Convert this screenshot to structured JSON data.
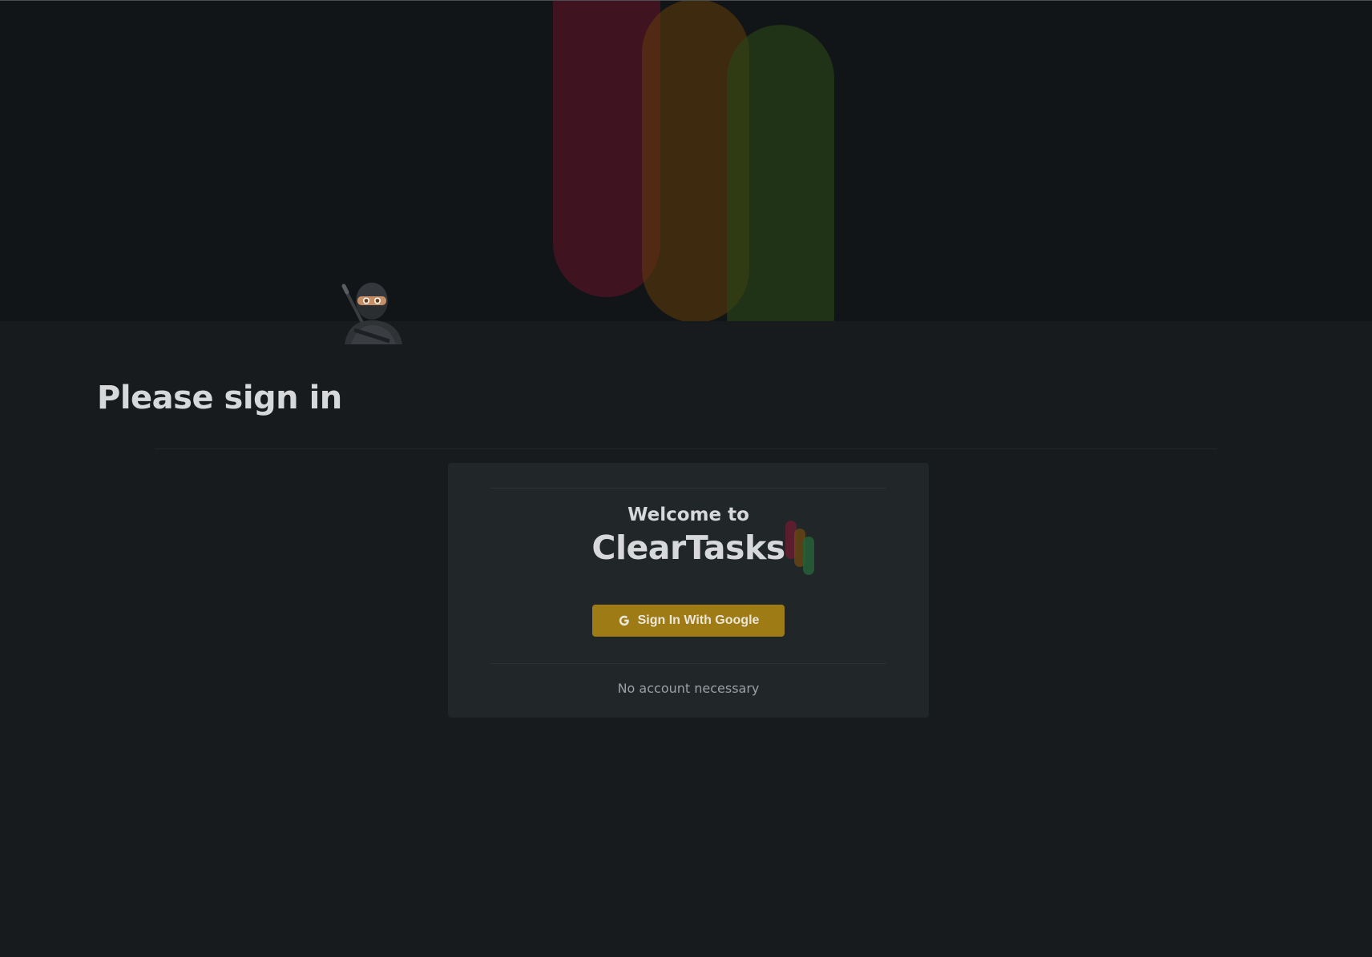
{
  "page": {
    "title": "Please sign in",
    "icon": "ninja-icon"
  },
  "banner": {
    "colors": [
      "#5c1226",
      "#623e0a",
      "#2a4616"
    ]
  },
  "card": {
    "welcome": "Welcome to",
    "brand": "ClearTasks",
    "logo_icon": "cleartasks-logo-icon",
    "sign_in_button": {
      "label": "Sign In With Google",
      "icon": "google-icon",
      "color": "#9e7b14"
    },
    "note": "No account necessary"
  }
}
